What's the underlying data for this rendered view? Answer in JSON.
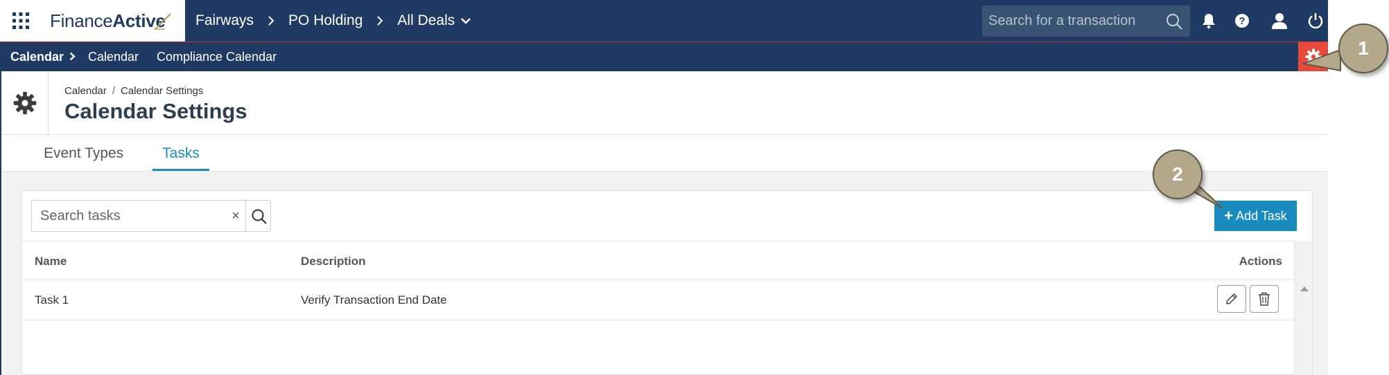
{
  "topbar": {
    "logo_primary": "Finance",
    "logo_secondary": "Active",
    "breadcrumbs": [
      "Fairways",
      "PO Holding",
      "All Deals"
    ],
    "search_placeholder": "Search for a transaction"
  },
  "subnav": {
    "section": "Calendar",
    "items": [
      "Calendar",
      "Compliance Calendar"
    ]
  },
  "callouts": [
    "1",
    "2"
  ],
  "page": {
    "breadcrumb": [
      "Calendar",
      "Calendar Settings"
    ],
    "breadcrumb_separator": "/",
    "title": "Calendar Settings"
  },
  "tabs": [
    {
      "label": "Event Types",
      "active": false
    },
    {
      "label": "Tasks",
      "active": true
    }
  ],
  "tasks": {
    "search_placeholder": "Search tasks",
    "clear_symbol": "×",
    "add_button_icon": "+",
    "add_button_label": "Add Task",
    "columns": [
      "Name",
      "Description",
      "Actions"
    ],
    "rows": [
      {
        "name": "Task 1",
        "description": "Verify Transaction End Date"
      }
    ]
  },
  "colors": {
    "navy": "#1f3b63",
    "accent_blue": "#1a8bbf",
    "settings_red": "#e8493a",
    "callout_tan": "#b3a98a"
  },
  "icons": [
    "apps-grid-icon",
    "chevron-right-icon",
    "chevron-down-icon",
    "search-icon",
    "bell-icon",
    "help-icon",
    "user-icon",
    "power-icon",
    "gear-icon",
    "close-icon",
    "pencil-icon",
    "trash-icon"
  ]
}
